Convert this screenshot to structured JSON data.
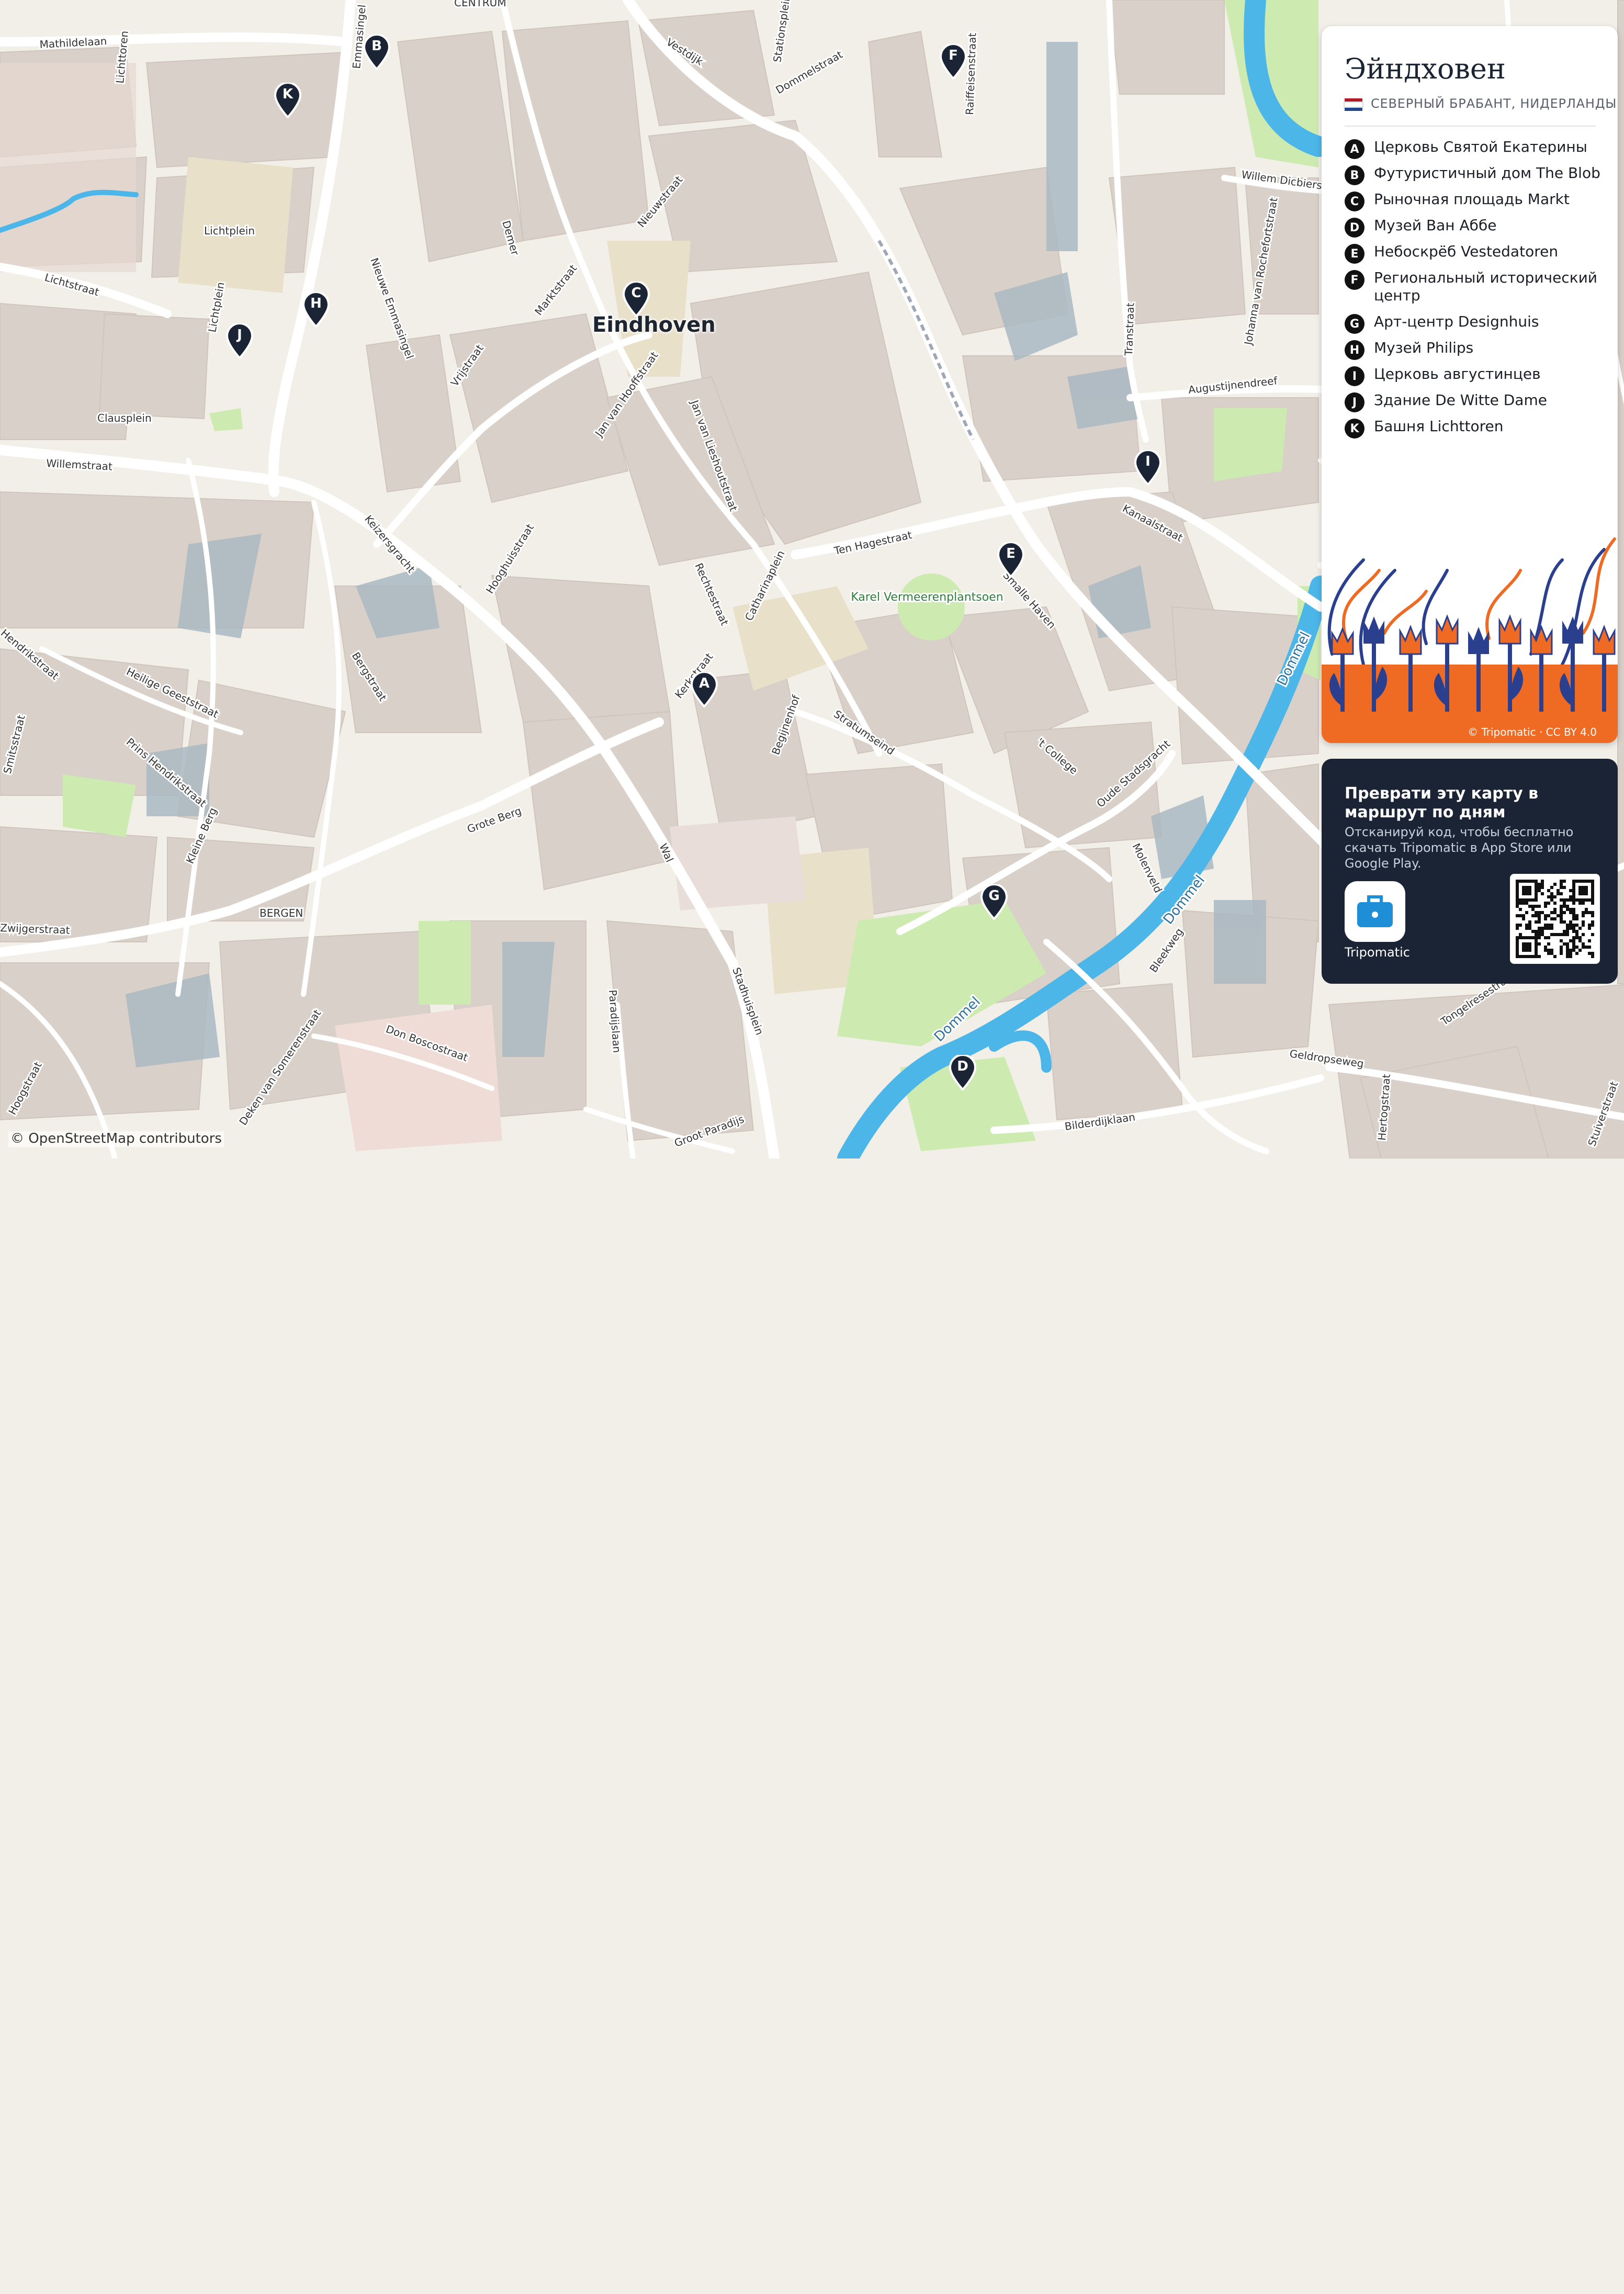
{
  "map": {
    "city_label": "Eindhoven",
    "attribution": "© OpenStreetMap contributors",
    "street_labels": [
      "Mathildelaan",
      "Lichttoren",
      "Emmasingel",
      "CENTRUM",
      "Stationsplein",
      "Dommelstraat",
      "Raiffeisenstraat",
      "Vestdijk",
      "Nieuwstraat",
      "Demer",
      "Marktstraat",
      "Nieuwe Emmasingel",
      "Vrijstraat",
      "Lichtplein",
      "Lichtstraat",
      "Clausplein",
      "Willemstraat",
      "Keizersgracht",
      "Jan van Hooffstraat",
      "Jan van Lieshoutstraat",
      "Hooghuisstraat",
      "Rechtestraat",
      "Catharinaplein",
      "Ten Hagestraat",
      "Kerkstraat",
      "Karel Vermeerenplantsoen",
      "Smalle Haven",
      "Kanaalstraat",
      "Transtraat",
      "Johanna van Rochefortstraat",
      "Augustijnendreef",
      "Willem Dicbierstraat",
      "Stratumseind",
      "Begijnenhof",
      "'t College",
      "Oude Stadsgracht",
      "Molenveld",
      "Dommel",
      "Bleekweg",
      "Stadhuisplein",
      "Paradijslaan",
      "Wal",
      "Grote Berg",
      "BERGEN",
      "Don Boscostraat",
      "Deken van Somerenstraat",
      "Hoogstraat",
      "Kleine Berg",
      "Bergstraat",
      "Heilige Geeststraat",
      "Prins Hendrikstraat",
      "Hendrikstraat",
      "Smitsstraat",
      "Groot Paradijs",
      "Bilderdijklaan",
      "Geldropseweg",
      "Hertogstraat",
      "Tongelresestraat",
      "Stuiverstraat",
      "Lichtplein",
      "Zwijgerstraat",
      "Jan van Lieshoutstraat"
    ],
    "markers": [
      {
        "letter": "A"
      },
      {
        "letter": "B"
      },
      {
        "letter": "C"
      },
      {
        "letter": "D"
      },
      {
        "letter": "E"
      },
      {
        "letter": "F"
      },
      {
        "letter": "G"
      },
      {
        "letter": "H"
      },
      {
        "letter": "I"
      },
      {
        "letter": "J"
      },
      {
        "letter": "K"
      }
    ],
    "colors": {
      "land": "#f2efe9",
      "building": "#d9d0c9",
      "road": "#ffffff",
      "water": "#4db6e8",
      "park": "#cdebb0",
      "marker": "#1b2435"
    }
  },
  "panel": {
    "title": "Эйндховен",
    "subtitle": "СЕВЕРНЫЙ БРАБАНТ, НИДЕРЛАНДЫ",
    "flag_colors": [
      "#ae1c28",
      "#ffffff",
      "#21468b"
    ],
    "legend": [
      {
        "letter": "A",
        "name": "Церковь Святой Екатерины"
      },
      {
        "letter": "B",
        "name": "Футуристичный дом The Blob"
      },
      {
        "letter": "C",
        "name": "Рыночная площадь Markt"
      },
      {
        "letter": "D",
        "name": "Музей Ван Аббе"
      },
      {
        "letter": "E",
        "name": "Небоскрёб Vestedatoren"
      },
      {
        "letter": "F",
        "name": "Региональный исторический центр"
      },
      {
        "letter": "G",
        "name": "Арт-центр Designhuis"
      },
      {
        "letter": "H",
        "name": "Музей Philips"
      },
      {
        "letter": "I",
        "name": "Церковь августинцев"
      },
      {
        "letter": "J",
        "name": "Здание De Witte Dame"
      },
      {
        "letter": "K",
        "name": "Башня Lichttoren"
      }
    ],
    "art_credit": "© Tripomatic · CC BY 4.0"
  },
  "promo": {
    "heading": "Преврати эту карту в маршрут по дням",
    "text": "Отсканируй код, чтобы бесплатно скачать Tripomatic в App Store или Google Play.",
    "app_name": "Tripomatic"
  }
}
